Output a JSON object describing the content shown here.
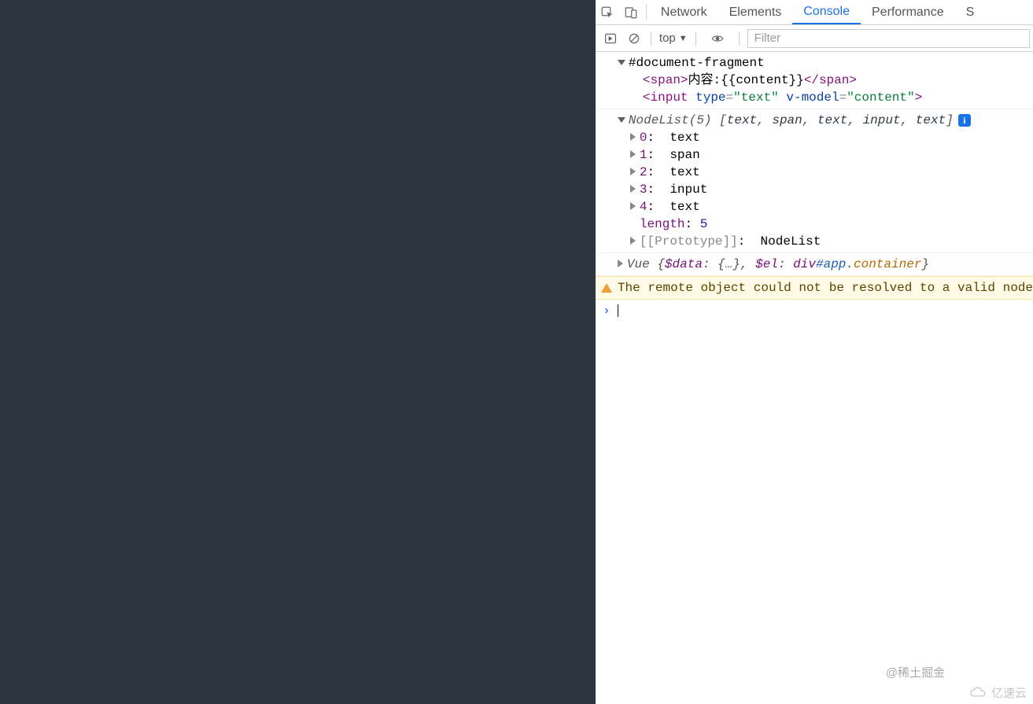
{
  "tabs": {
    "network": "Network",
    "elements": "Elements",
    "console": "Console",
    "performance": "Performance",
    "partial": "S"
  },
  "toolbar": {
    "scope": "top",
    "filter_placeholder": "Filter"
  },
  "console_out": {
    "doc_fragment": "#document-fragment",
    "span_open": "<span>",
    "span_text_pre": "内容:",
    "span_text_tpl": "{{content}}",
    "span_close": "</span>",
    "input_tag": "<input",
    "input_type_attr": "type",
    "input_eq": "=",
    "input_type_val": "\"text\"",
    "input_vmodel_attr": "v-model",
    "input_vmodel_val": "\"content\"",
    "input_end": ">",
    "nodelist_label": "NodeList(5) ",
    "nodelist_items": [
      "text",
      "span",
      "text",
      "input",
      "text"
    ],
    "entries": [
      {
        "idx": "0",
        "val": "text"
      },
      {
        "idx": "1",
        "val": "span"
      },
      {
        "idx": "2",
        "val": "text"
      },
      {
        "idx": "3",
        "val": "input"
      },
      {
        "idx": "4",
        "val": "text"
      }
    ],
    "length_label": "length",
    "length_val": "5",
    "proto_label": "[[Prototype]]",
    "proto_val": "NodeList",
    "vue_label": "Vue ",
    "vue_data_key": "$data",
    "vue_data_val": "{…}",
    "vue_el_key": "$el",
    "vue_el_tag": "div",
    "vue_el_id": "#app",
    "vue_el_dot": ".",
    "vue_el_cls": "container",
    "warning": "The remote object could not be resolved to a valid node"
  },
  "watermarks": {
    "w1": "@稀土掘金",
    "w2": "亿速云"
  }
}
